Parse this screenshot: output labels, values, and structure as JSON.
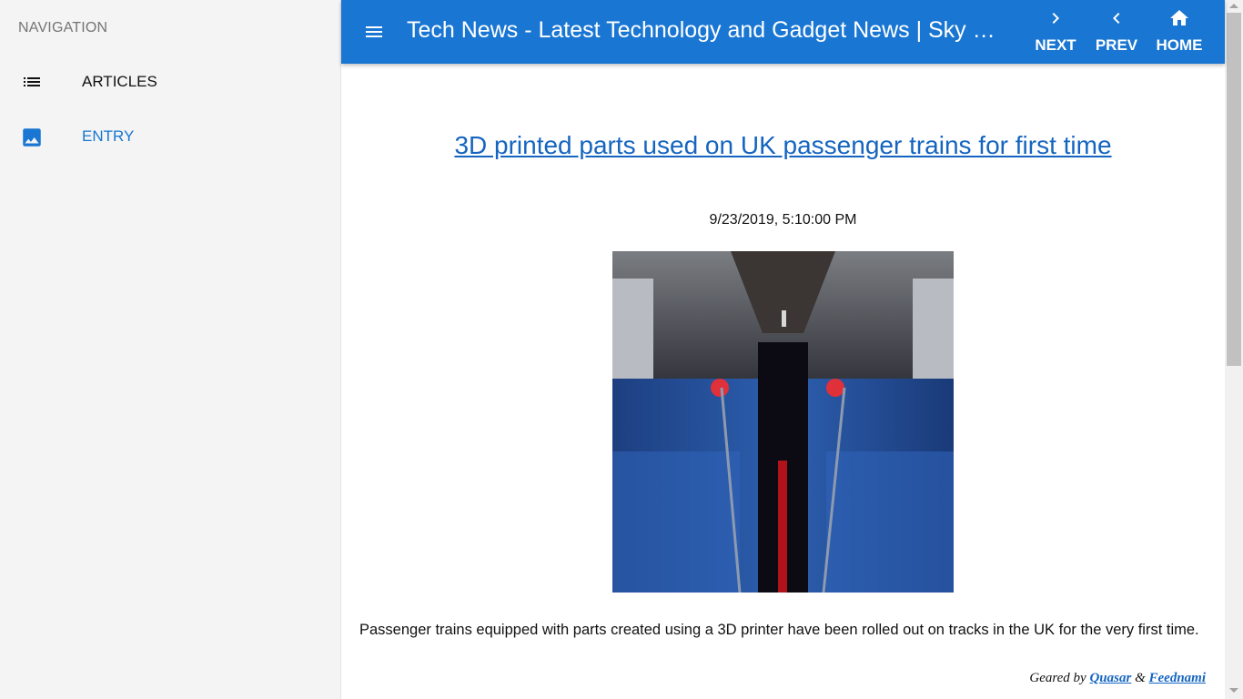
{
  "sidebar": {
    "header": "NAVIGATION",
    "items": [
      {
        "label": "ARTICLES",
        "icon": "list-icon",
        "active": false
      },
      {
        "label": "ENTRY",
        "icon": "image-icon",
        "active": true
      }
    ]
  },
  "toolbar": {
    "title": "Tech News - Latest Technology and Gadget News | Sky News",
    "next_label": "NEXT",
    "prev_label": "PREV",
    "home_label": "HOME"
  },
  "article": {
    "title": "3D printed parts used on UK passenger trains for first time",
    "date": "9/23/2019, 5:10:00 PM",
    "image": "train-interior-photo",
    "body": "Passenger trains equipped with parts created using a 3D printer have been rolled out on tracks in the UK for the very first time."
  },
  "footer": {
    "prefix": "Geared by",
    "link1": "Quasar",
    "separator": "&",
    "link2": "Feednami"
  },
  "colors": {
    "primary": "#1976d2",
    "link": "#1565c0",
    "sidebar_bg": "#f4f4f4"
  }
}
